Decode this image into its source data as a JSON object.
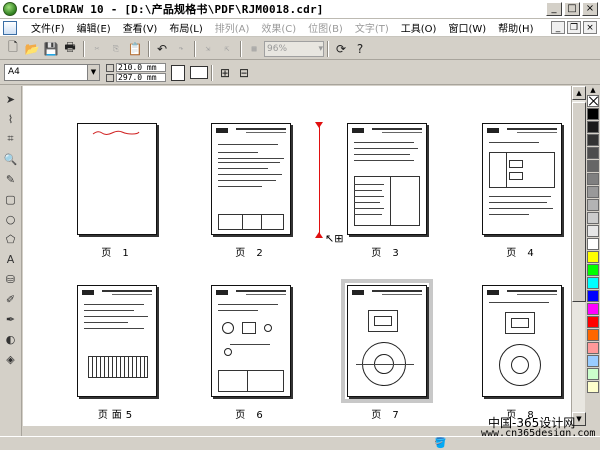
{
  "window": {
    "title": "CorelDRAW 10 - [D:\\产品规格书\\PDF\\RJM0018.cdr]",
    "buttons": {
      "minimize": "_",
      "maximize": "□",
      "close": "×"
    }
  },
  "menu": {
    "items": [
      {
        "label": "文件(F)",
        "enabled": true
      },
      {
        "label": "编辑(E)",
        "enabled": true
      },
      {
        "label": "查看(V)",
        "enabled": true
      },
      {
        "label": "布局(L)",
        "enabled": true
      },
      {
        "label": "排列(A)",
        "enabled": false
      },
      {
        "label": "效果(C)",
        "enabled": false
      },
      {
        "label": "位图(B)",
        "enabled": false
      },
      {
        "label": "文字(T)",
        "enabled": false
      },
      {
        "label": "工具(O)",
        "enabled": true
      },
      {
        "label": "窗口(W)",
        "enabled": true
      },
      {
        "label": "帮助(H)",
        "enabled": true
      }
    ]
  },
  "toolbar": {
    "zoom_value": "96%"
  },
  "propertybar": {
    "page_size": "A4",
    "width": "210.0 mm",
    "height": "297.0 mm"
  },
  "pages": [
    {
      "label": "页 1",
      "selected": false
    },
    {
      "label": "页 2",
      "selected": false
    },
    {
      "label": "页 3",
      "selected": false
    },
    {
      "label": "页 4",
      "selected": false
    },
    {
      "label": "页面5",
      "selected": false
    },
    {
      "label": "页 6",
      "selected": false
    },
    {
      "label": "页 7",
      "selected": true
    },
    {
      "label": "页 8",
      "selected": false
    }
  ],
  "palette": [
    "#000000",
    "#1a1a1a",
    "#333333",
    "#4d4d4d",
    "#666666",
    "#808080",
    "#999999",
    "#b3b3b3",
    "#cccccc",
    "#e6e6e6",
    "#ffffff",
    "#ffff00",
    "#00ff00",
    "#00ffff",
    "#0000ff",
    "#ff00ff",
    "#ff0000",
    "#ff6600",
    "#ff9999",
    "#99ccff",
    "#ccffcc",
    "#ffffcc"
  ],
  "watermark": {
    "line1": "中国-365设计网",
    "line2": "www.cn365design.com"
  },
  "colors": {
    "insertion_marker": "#e01010"
  }
}
